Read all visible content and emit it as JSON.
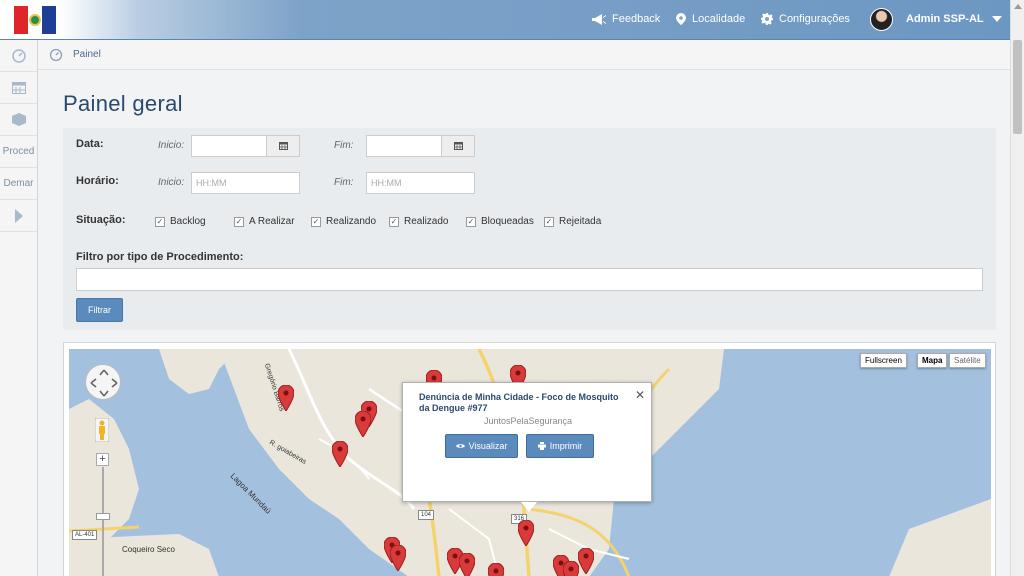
{
  "nav": {
    "feedback": "Feedback",
    "localidade": "Localidade",
    "configuracoes": "Configurações",
    "user": "Admin SSP-AL"
  },
  "sidebar": {
    "items": [
      {
        "icon": "dashboard-icon",
        "label": ""
      },
      {
        "icon": "calendar-icon",
        "label": ""
      },
      {
        "icon": "box-icon",
        "label": ""
      },
      {
        "icon": "procedure-icon",
        "label": "Proced"
      },
      {
        "icon": "demand-icon",
        "label": "Demar"
      },
      {
        "icon": "expand-arrow-icon",
        "label": ""
      }
    ]
  },
  "breadcrumb": {
    "current": "Painel"
  },
  "page": {
    "title": "Painel geral"
  },
  "filters": {
    "data_label": "Data:",
    "horario_label": "Horário:",
    "inicio_label": "Inicio:",
    "fim_label": "Fim:",
    "time_placeholder": "HH:MM",
    "situacao_label": "Situação:",
    "situacoes": [
      {
        "label": "Backlog",
        "checked": true
      },
      {
        "label": "A Realizar",
        "checked": true
      },
      {
        "label": "Realizando",
        "checked": true
      },
      {
        "label": "Realizado",
        "checked": true
      },
      {
        "label": "Bloqueadas",
        "checked": true
      },
      {
        "label": "Rejeitada",
        "checked": true
      }
    ],
    "procedimento_label": "Filtro por tipo de Procedimento:",
    "procedimento_value": "",
    "filter_button": "Filtrar"
  },
  "map": {
    "fullscreen": "Fullscreen",
    "mapa": "Mapa",
    "satelite": "Satélite",
    "labels": {
      "lagoa": "Lagoa Mundaú",
      "coqueiro": "Coqueiro Seco",
      "road_barros": "Gregório Barros",
      "road_goiabeiras": "R. goiabeiras",
      "al401": "AL-401",
      "r104": "104",
      "r316": "316"
    },
    "popup": {
      "title": "Denúncia de Minha Cidade - Foco de Mosquito da Dengue #977",
      "subtitle": "JuntosPelaSegurança",
      "visualizar": "Visualizar",
      "imprimir": "Imprimir"
    },
    "marker_color": "#d93a3a"
  },
  "colors": {
    "accent": "#5b8bbd",
    "title": "#2a4a6d",
    "navbar": "#6c97c2"
  }
}
